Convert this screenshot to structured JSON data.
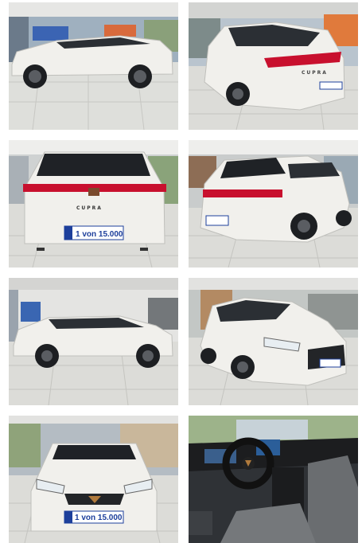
{
  "gallery": {
    "photos": [
      {
        "view": "side-left"
      },
      {
        "view": "rear-right-three-quarter",
        "badge": "CUPRA"
      },
      {
        "view": "rear",
        "badge": "CUPRA",
        "plate": "1 von 15.000"
      },
      {
        "view": "rear-left-three-quarter",
        "plate": "1 von 15.000"
      },
      {
        "view": "side-left-showroom"
      },
      {
        "view": "front-left-three-quarter",
        "plate": "1 von 15.000"
      },
      {
        "view": "front",
        "plate": "1 von 15.000"
      },
      {
        "view": "interior-cockpit"
      }
    ]
  },
  "colors": {
    "car_body": "#f1f0ec",
    "tail_light": "#c8102e",
    "plate_blue": "#1d3f9b",
    "floor_tile": "#dcdcd8"
  }
}
